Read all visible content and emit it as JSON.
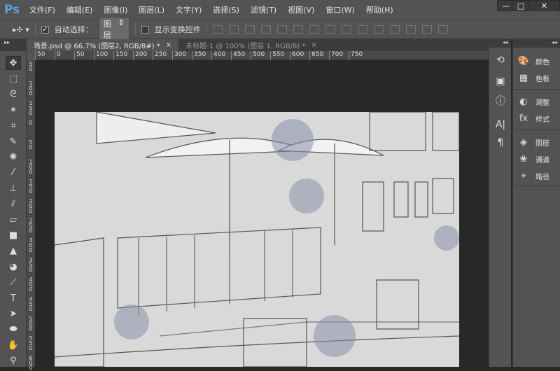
{
  "app": {
    "logo": "Ps"
  },
  "menu": [
    "文件(F)",
    "编辑(E)",
    "图像(I)",
    "图层(L)",
    "文字(Y)",
    "选择(S)",
    "滤镜(T)",
    "视图(V)",
    "窗口(W)",
    "帮助(H)"
  ],
  "window_controls": {
    "minimize": "—",
    "maximize": "□",
    "close": "✕"
  },
  "options": {
    "auto_select_label": "自动选择：",
    "auto_select_checked": true,
    "auto_select_value": "图层",
    "show_transform_label": "显示变换控件",
    "show_transform_checked": false
  },
  "tabs": [
    {
      "label": "场景.psd @ 66.7% (图层2, RGB/8#) *",
      "close": "×",
      "active": true
    },
    {
      "label": "未标题-1 @ 100% (图层 1, RGB/8) *",
      "close": "×",
      "active": false
    }
  ],
  "hruler": [
    "50",
    "0",
    "50",
    "100",
    "150",
    "200",
    "250",
    "300",
    "350",
    "400",
    "450",
    "500",
    "550",
    "600",
    "650",
    "700",
    "750"
  ],
  "vruler": [
    "50",
    "100",
    "150",
    "0",
    "50",
    "100",
    "150",
    "200",
    "250",
    "300",
    "350",
    "400",
    "450",
    "500",
    "550",
    "600"
  ],
  "tools": [
    "move",
    "marquee",
    "lasso",
    "magic-wand",
    "crop",
    "eyedropper",
    "healing",
    "brush",
    "stamp",
    "history-brush",
    "eraser",
    "gradient",
    "blur",
    "dodge",
    "pen",
    "type",
    "path-select",
    "ellipse",
    "hand",
    "zoom"
  ],
  "panels": [
    {
      "icon": "palette",
      "label": "颜色"
    },
    {
      "icon": "swatches",
      "label": "色板"
    },
    {
      "icon": "adjustments",
      "label": "调整"
    },
    {
      "icon": "styles",
      "label": "样式"
    },
    {
      "icon": "layers",
      "label": "图层"
    },
    {
      "icon": "channels",
      "label": "通道"
    },
    {
      "icon": "paths",
      "label": "路径"
    }
  ],
  "strip_icons": [
    "history",
    "actions",
    "info",
    "character",
    "paragraph"
  ]
}
